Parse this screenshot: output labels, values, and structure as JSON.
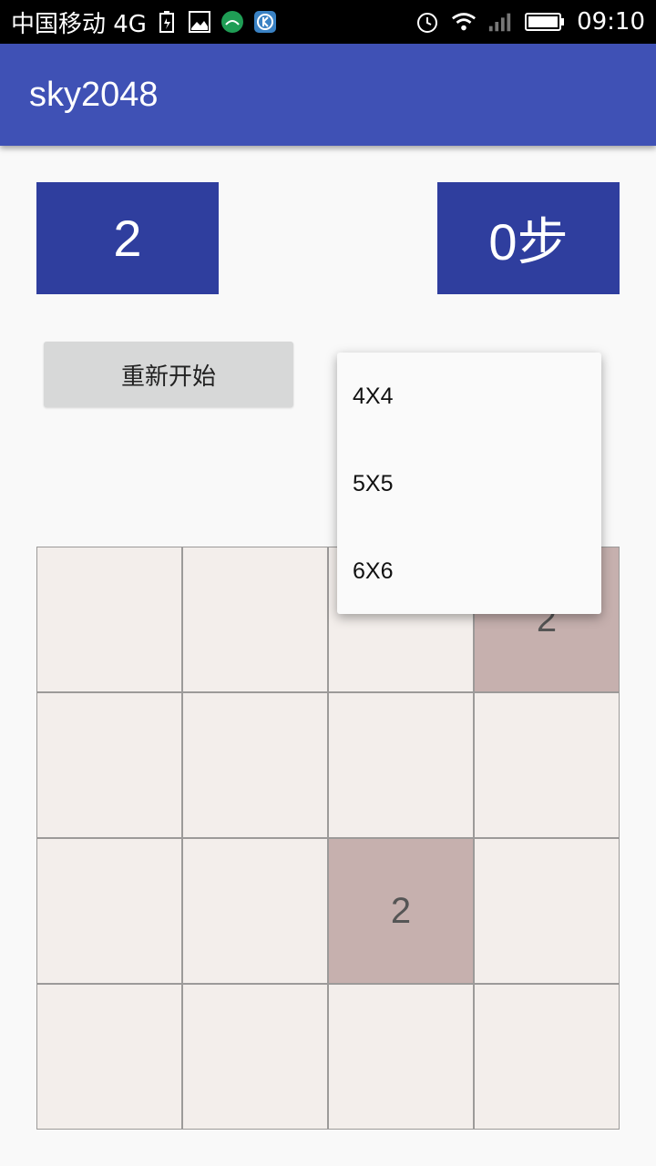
{
  "status_bar": {
    "carrier": "中国移动 4G",
    "time": "09:10",
    "icons_left": [
      "battery-saver-icon",
      "image-icon",
      "app-icon",
      "k-app-icon"
    ],
    "icons_right": [
      "alarm-icon",
      "wifi-icon",
      "signal-icon",
      "battery-icon"
    ]
  },
  "app_bar": {
    "title": "sky2048"
  },
  "scores": {
    "score": "2",
    "steps": "0步"
  },
  "restart": {
    "label": "重新开始"
  },
  "size_menu": {
    "options": [
      "4X4",
      "5X5",
      "6X6"
    ]
  },
  "board": {
    "size": 4,
    "cells": [
      [
        "",
        "",
        "",
        "2"
      ],
      [
        "",
        "",
        "",
        ""
      ],
      [
        "",
        "",
        "2",
        ""
      ],
      [
        "",
        "",
        "",
        ""
      ]
    ]
  },
  "colors": {
    "app_bar": "#3f51b5",
    "score_box": "#2f3e9e",
    "cell_empty": "#f3eeeb",
    "cell_two": "#c6b0ae"
  }
}
